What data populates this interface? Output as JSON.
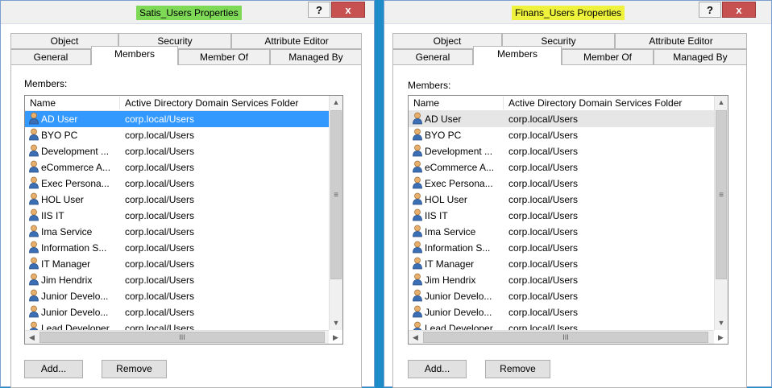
{
  "colors": {
    "desktop": "#1d8cc9",
    "selected_row": "#3399ff",
    "highlight_green": "#7ed957",
    "highlight_yellow": "#eef23c"
  },
  "common": {
    "tabs_row1": [
      "Object",
      "Security",
      "Attribute Editor"
    ],
    "tabs_row2": [
      "General",
      "Members",
      "Member Of",
      "Managed By"
    ],
    "members_label": "Members:",
    "col_name": "Name",
    "col_folder": "Active Directory Domain Services Folder",
    "add_button": "Add...",
    "remove_button": "Remove",
    "help_glyph": "?",
    "close_glyph": "x"
  },
  "dialogs": [
    {
      "title": "Satis_Users Properties",
      "selected_row": "AD User",
      "members": [
        {
          "name": "AD User",
          "folder": "corp.local/Users"
        },
        {
          "name": "BYO PC",
          "folder": "corp.local/Users"
        },
        {
          "name": "Development ...",
          "folder": "corp.local/Users"
        },
        {
          "name": "eCommerce A...",
          "folder": "corp.local/Users"
        },
        {
          "name": "Exec Persona...",
          "folder": "corp.local/Users"
        },
        {
          "name": "HOL User",
          "folder": "corp.local/Users"
        },
        {
          "name": "IIS IT",
          "folder": "corp.local/Users"
        },
        {
          "name": "Ima Service",
          "folder": "corp.local/Users"
        },
        {
          "name": "Information S...",
          "folder": "corp.local/Users"
        },
        {
          "name": "IT Manager",
          "folder": "corp.local/Users"
        },
        {
          "name": "Jim Hendrix",
          "folder": "corp.local/Users"
        },
        {
          "name": "Junior Develo...",
          "folder": "corp.local/Users"
        },
        {
          "name": "Junior Develo...",
          "folder": "corp.local/Users"
        },
        {
          "name": "Lead Developer",
          "folder": "corp.local/Users"
        }
      ]
    },
    {
      "title": "Finans_Users Properties",
      "selected_row": "AD User",
      "members": [
        {
          "name": "AD User",
          "folder": "corp.local/Users"
        },
        {
          "name": "BYO PC",
          "folder": "corp.local/Users"
        },
        {
          "name": "Development ...",
          "folder": "corp.local/Users"
        },
        {
          "name": "eCommerce A...",
          "folder": "corp.local/Users"
        },
        {
          "name": "Exec Persona...",
          "folder": "corp.local/Users"
        },
        {
          "name": "HOL User",
          "folder": "corp.local/Users"
        },
        {
          "name": "IIS IT",
          "folder": "corp.local/Users"
        },
        {
          "name": "Ima Service",
          "folder": "corp.local/Users"
        },
        {
          "name": "Information S...",
          "folder": "corp.local/Users"
        },
        {
          "name": "IT Manager",
          "folder": "corp.local/Users"
        },
        {
          "name": "Jim Hendrix",
          "folder": "corp.local/Users"
        },
        {
          "name": "Junior Develo...",
          "folder": "corp.local/Users"
        },
        {
          "name": "Junior Develo...",
          "folder": "corp.local/Users"
        },
        {
          "name": "Lead Developer",
          "folder": "corp.local/Users"
        }
      ]
    }
  ]
}
